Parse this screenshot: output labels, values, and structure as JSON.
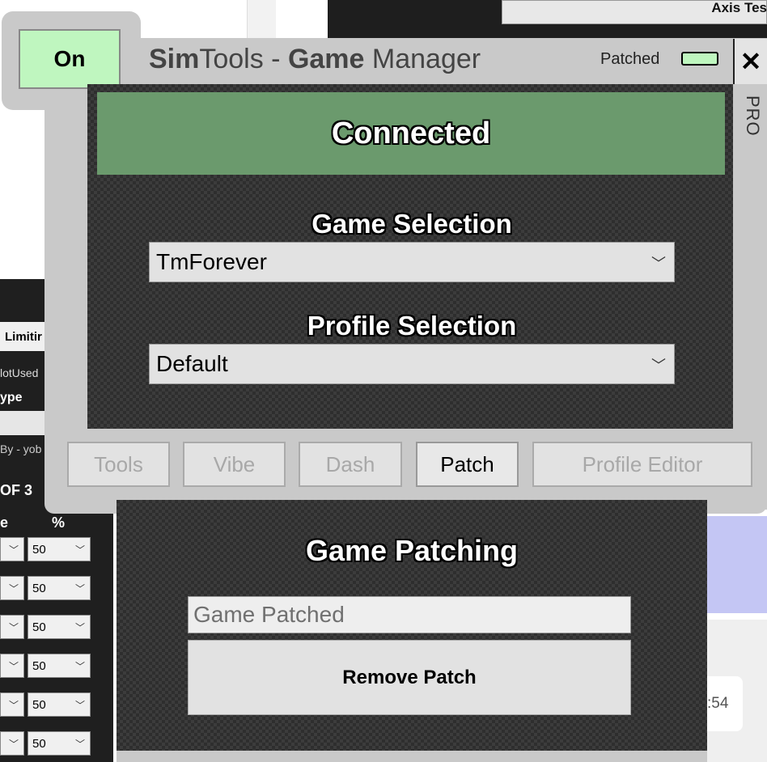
{
  "background": {
    "axis_text": "Axis Tes",
    "limit_tab": "Limitir",
    "notused": "lotUsed",
    "type": "ype",
    "by": "By - yob",
    "dof": "OF 3",
    "e_header": "e",
    "pct_header": "%",
    "select_value": "50",
    "bubble_text": ":54"
  },
  "window": {
    "on_button": "On",
    "title_sim": "Sim",
    "title_tools": "Tools - ",
    "title_game": "Game",
    "title_manager": " Manager",
    "patched_label": "Patched",
    "close_label": "✕",
    "pro_label": "PRO",
    "connected": "Connected",
    "game_selection_label": "Game Selection",
    "game_selection_value": "TmForever",
    "profile_selection_label": "Profile Selection",
    "profile_selection_value": "Default"
  },
  "tabs": {
    "tools": "Tools",
    "vibe": "Vibe",
    "dash": "Dash",
    "patch": "Patch",
    "profile_editor": "Profile Editor",
    "active": "patch"
  },
  "patch_panel": {
    "title": "Game Patching",
    "status": "Game Patched",
    "remove_button": "Remove Patch"
  },
  "colors": {
    "on_green": "#bff6bf",
    "connected_band": "#6b9a6d",
    "window_gray": "#c9c9c9"
  },
  "icons": {
    "close": "close-icon",
    "dropdown": "chevron-down-icon"
  }
}
